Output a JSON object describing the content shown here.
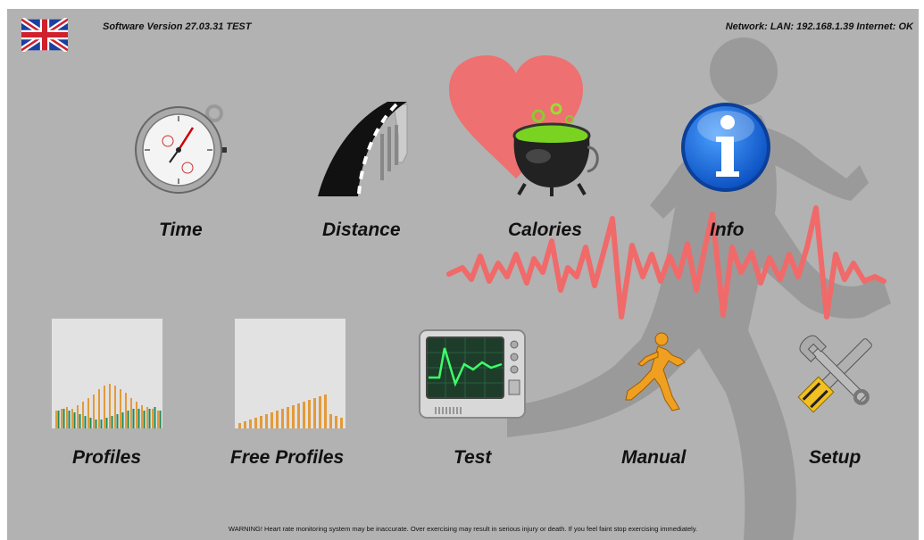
{
  "header": {
    "flag_icon": "uk-flag-icon",
    "software_version": "Software Version 27.03.31 TEST",
    "network_status": "Network: LAN: 192.168.1.39 Internet: OK"
  },
  "menu": {
    "top_row": [
      {
        "label": "Time",
        "icon": "stopwatch-icon"
      },
      {
        "label": "Distance",
        "icon": "road-icon"
      },
      {
        "label": "Calories",
        "icon": "cauldron-icon"
      },
      {
        "label": "Info",
        "icon": "info-icon"
      }
    ],
    "bottom_row": [
      {
        "label": "Profiles",
        "icon": "profiles-chart-icon"
      },
      {
        "label": "Free Profiles",
        "icon": "free-profiles-chart-icon"
      },
      {
        "label": "Test",
        "icon": "monitor-icon"
      },
      {
        "label": "Manual",
        "icon": "runner-icon"
      },
      {
        "label": "Setup",
        "icon": "tools-icon"
      }
    ]
  },
  "background": {
    "heart_color": "#f07070",
    "runner_color": "#8f8f8f"
  },
  "footer": {
    "warning": "WARNING! Heart rate monitoring system may be inaccurate. Over exercising may result in serious injury or death. If you feel faint stop exercising immediately."
  }
}
